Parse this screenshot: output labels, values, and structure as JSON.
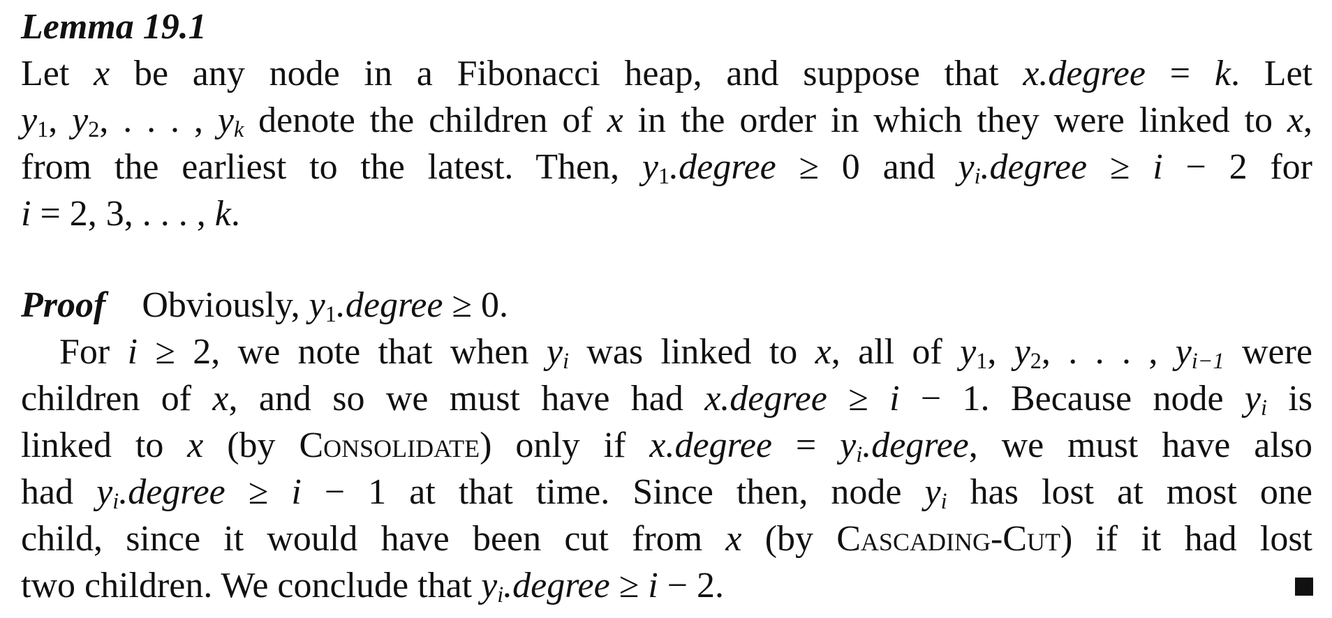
{
  "lemma": {
    "title": "Lemma 19.1",
    "lines": [
      [
        {
          "t": "Let "
        },
        {
          "t": "x",
          "m": 1
        },
        {
          "t": " be any node in a Fibonacci heap, and suppose that "
        },
        {
          "t": "x.degree",
          "m": 1
        },
        {
          "t": " = "
        },
        {
          "t": "k",
          "m": 1
        },
        {
          "t": ". Let"
        }
      ],
      [
        {
          "t": "y",
          "m": 1
        },
        {
          "t": "1",
          "sub": 1
        },
        {
          "t": ", "
        },
        {
          "t": "y",
          "m": 1
        },
        {
          "t": "2",
          "sub": 1
        },
        {
          "t": ", . . . , "
        },
        {
          "t": "y",
          "m": 1
        },
        {
          "t": "k",
          "sub": 1,
          "m": 1
        },
        {
          "t": " denote the children of "
        },
        {
          "t": "x",
          "m": 1
        },
        {
          "t": " in the order in which they were linked to "
        },
        {
          "t": "x",
          "m": 1
        },
        {
          "t": ","
        }
      ],
      [
        {
          "t": "from the earliest to the latest.  Then, "
        },
        {
          "t": "y",
          "m": 1
        },
        {
          "t": "1",
          "sub": 1
        },
        {
          "t": ".degree",
          "m": 1
        },
        {
          "t": " ≥ 0 and "
        },
        {
          "t": "y",
          "m": 1
        },
        {
          "t": "i",
          "sub": 1,
          "m": 1
        },
        {
          "t": ".degree",
          "m": 1
        },
        {
          "t": " ≥ "
        },
        {
          "t": "i",
          "m": 1
        },
        {
          "t": " − 2 for"
        }
      ],
      [
        {
          "t": "i",
          "m": 1
        },
        {
          "t": " = 2, 3, . . . , "
        },
        {
          "t": "k",
          "m": 1
        },
        {
          "t": "."
        }
      ]
    ]
  },
  "proof": {
    "title": "Proof",
    "lines": [
      [
        {
          "t": "Obviously, "
        },
        {
          "t": "y",
          "m": 1
        },
        {
          "t": "1",
          "sub": 1
        },
        {
          "t": ".degree",
          "m": 1
        },
        {
          "t": " ≥ 0."
        }
      ],
      [
        {
          "t": "For "
        },
        {
          "t": "i",
          "m": 1
        },
        {
          "t": " ≥ 2, we note that when "
        },
        {
          "t": "y",
          "m": 1
        },
        {
          "t": "i",
          "sub": 1,
          "m": 1
        },
        {
          "t": " was linked to "
        },
        {
          "t": "x",
          "m": 1
        },
        {
          "t": ", all of "
        },
        {
          "t": "y",
          "m": 1
        },
        {
          "t": "1",
          "sub": 1
        },
        {
          "t": ", "
        },
        {
          "t": "y",
          "m": 1
        },
        {
          "t": "2",
          "sub": 1
        },
        {
          "t": ", . . . , "
        },
        {
          "t": "y",
          "m": 1
        },
        {
          "t": "i−1",
          "sub": 1,
          "m": 1
        },
        {
          "t": " were"
        }
      ],
      [
        {
          "t": "children of "
        },
        {
          "t": "x",
          "m": 1
        },
        {
          "t": ", and so we must have had "
        },
        {
          "t": "x.degree",
          "m": 1
        },
        {
          "t": " ≥ "
        },
        {
          "t": "i",
          "m": 1
        },
        {
          "t": " − 1.  Because node "
        },
        {
          "t": "y",
          "m": 1
        },
        {
          "t": "i",
          "sub": 1,
          "m": 1
        },
        {
          "t": " is"
        }
      ],
      [
        {
          "t": "linked to "
        },
        {
          "t": "x",
          "m": 1
        },
        {
          "t": " (by "
        },
        {
          "t": "Consolidate",
          "sc": 1
        },
        {
          "t": ") only if "
        },
        {
          "t": "x.degree",
          "m": 1
        },
        {
          "t": " = "
        },
        {
          "t": "y",
          "m": 1
        },
        {
          "t": "i",
          "sub": 1,
          "m": 1
        },
        {
          "t": ".degree",
          "m": 1
        },
        {
          "t": ", we must have also"
        }
      ],
      [
        {
          "t": "had "
        },
        {
          "t": "y",
          "m": 1
        },
        {
          "t": "i",
          "sub": 1,
          "m": 1
        },
        {
          "t": ".degree",
          "m": 1
        },
        {
          "t": " ≥ "
        },
        {
          "t": "i",
          "m": 1
        },
        {
          "t": " − 1 at that time.  Since then, node "
        },
        {
          "t": "y",
          "m": 1
        },
        {
          "t": "i",
          "sub": 1,
          "m": 1
        },
        {
          "t": " has lost at most one"
        }
      ],
      [
        {
          "t": "child, since it would have been cut from "
        },
        {
          "t": "x",
          "m": 1
        },
        {
          "t": " (by "
        },
        {
          "t": "Cascading-Cut",
          "sc": 1
        },
        {
          "t": ") if it had lost"
        }
      ],
      [
        {
          "t": "two children. We conclude that "
        },
        {
          "t": "y",
          "m": 1
        },
        {
          "t": "i",
          "sub": 1,
          "m": 1
        },
        {
          "t": ".degree",
          "m": 1
        },
        {
          "t": " ≥ "
        },
        {
          "t": "i",
          "m": 1
        },
        {
          "t": " − 2."
        }
      ]
    ]
  }
}
